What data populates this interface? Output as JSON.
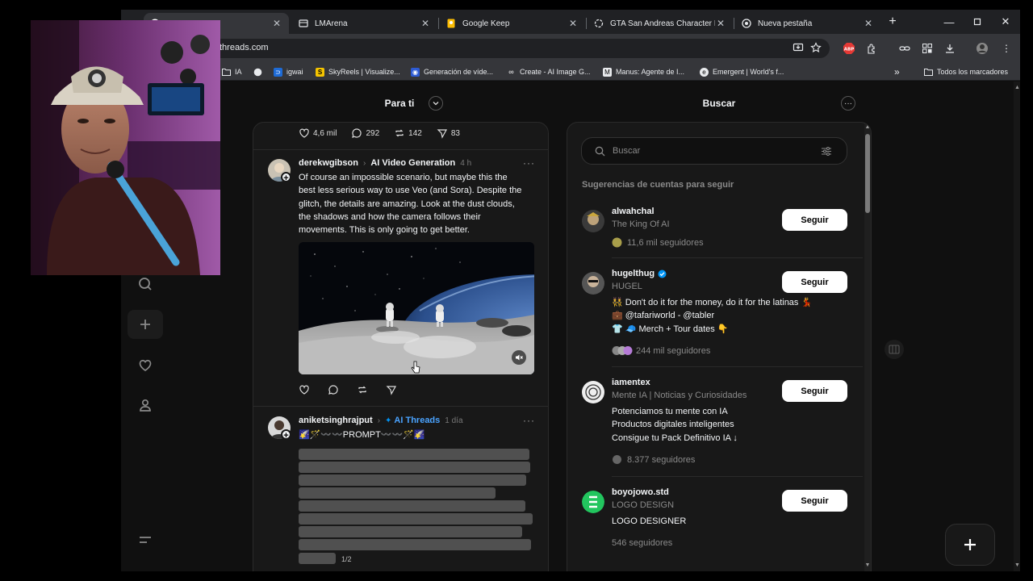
{
  "browser": {
    "tabs": [
      {
        "label": "",
        "active": true
      },
      {
        "label": "LMArena",
        "active": false
      },
      {
        "label": "Google Keep",
        "active": false
      },
      {
        "label": "GTA San Andreas Character Illu",
        "active": false
      },
      {
        "label": "Nueva pestaña",
        "active": false
      }
    ],
    "url": "threads.com",
    "bookmarks": [
      "IA",
      "",
      "igwai",
      "SkyReels | Visualize...",
      "Generación de víde...",
      "Create - AI Image G...",
      "Manus: Agente de I...",
      "Emergent | World's f..."
    ],
    "all_bookmarks": "Todos los marcadores",
    "adblock_badge": "ABP"
  },
  "threads": {
    "feed_title": "Para ti",
    "search_title": "Buscar",
    "top_actions": {
      "likes": "4,6 mil",
      "replies": "292",
      "reposts": "142",
      "shares": "83"
    },
    "posts": [
      {
        "user": "derekwgibson",
        "topic": "AI Video Generation",
        "time": "4 h",
        "text_lines": [
          "Of course an impossible scenario, but maybe this the",
          "best less serious way to use Veo (and Sora). Despite the",
          "glitch, the details are amazing. Look at the dust clouds,",
          "the shadows and how the camera follows their",
          "movements. This is only going to get better."
        ]
      },
      {
        "user": "aniketsinghrajput",
        "topic": "AI Threads",
        "time": "1 día",
        "text": "🌠🪄〰️〰️PROMPT〰️〰️🪄🌠",
        "page": "1/2"
      }
    ],
    "search": {
      "placeholder": "Buscar",
      "suggestions_title": "Sugerencias de cuentas para seguir",
      "follow_label": "Seguir",
      "accounts": [
        {
          "username": "alwahchal",
          "name": "The King Of AI",
          "bio": [],
          "followers": "11,6 mil seguidores",
          "verified": false
        },
        {
          "username": "hugelthug",
          "name": "HUGEL",
          "bio": [
            "👯 Don't do it for the money, do it for the latinas 💃",
            "💼 @tafariworld - @tabler",
            "👕 🧢 Merch + Tour dates 👇"
          ],
          "followers": "244 mil seguidores",
          "verified": true
        },
        {
          "username": "iamentex",
          "name": "Mente IA | Noticias y Curiosidades",
          "bio": [
            "Potenciamos tu mente con IA",
            "Productos digitales inteligentes",
            "Consigue tu Pack Definitivo IA ↓"
          ],
          "followers": "8.377 seguidores",
          "verified": false
        },
        {
          "username": "boyojowo.std",
          "name": "LOGO DESIGN",
          "bio": [
            "LOGO DESIGNER"
          ],
          "followers": "546 seguidores",
          "verified": false
        }
      ]
    }
  },
  "colors": {
    "accent_blue": "#0095f6",
    "follow_bg": "#ffffff",
    "bg": "#101010",
    "card": "#181818"
  }
}
